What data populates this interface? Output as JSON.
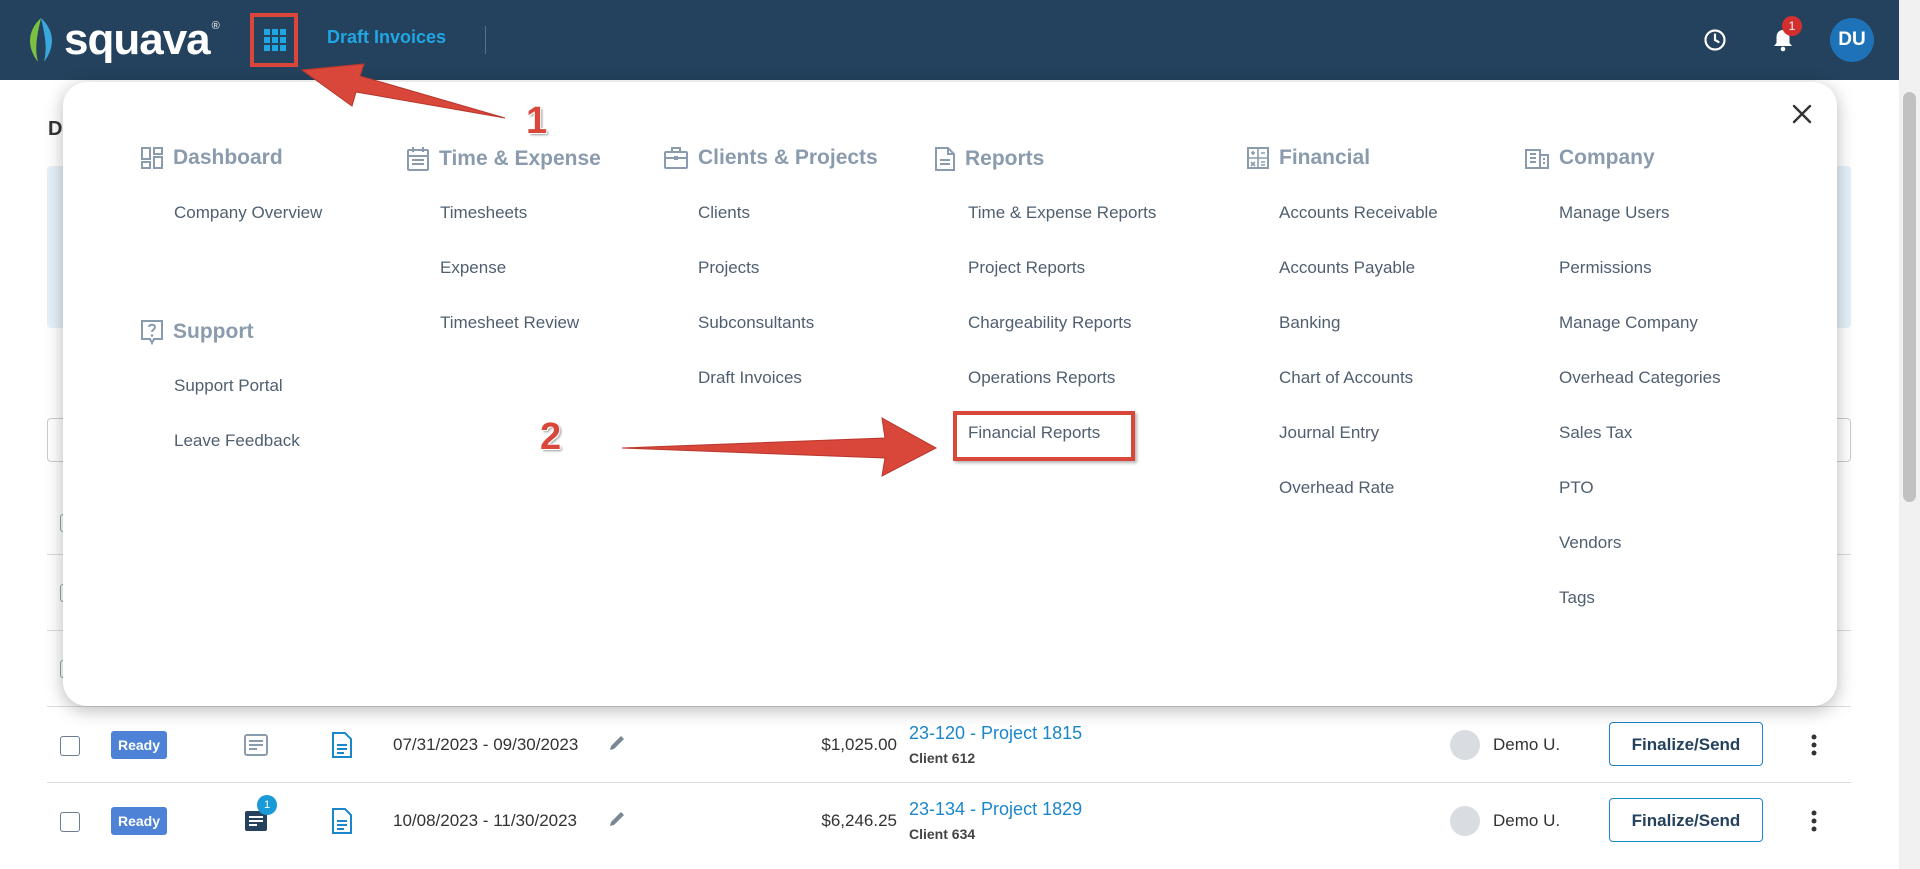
{
  "header": {
    "logo_text": "squava",
    "logo_mark": "®",
    "page_title": "Draft Invoices",
    "notification_count": "1",
    "user_initials": "DU"
  },
  "background": {
    "heading_fragment": "D"
  },
  "menu": {
    "columns": [
      {
        "heading": "Dashboard",
        "icon": "dashboard-icon",
        "items": [
          "Company Overview"
        ]
      },
      {
        "heading": "Time & Expense",
        "icon": "calendar-icon",
        "items": [
          "Timesheets",
          "Expense",
          "Timesheet Review"
        ]
      },
      {
        "heading": "Clients & Projects",
        "icon": "briefcase-icon",
        "items": [
          "Clients",
          "Projects",
          "Subconsultants",
          "Draft Invoices"
        ]
      },
      {
        "heading": "Reports",
        "icon": "report-icon",
        "items": [
          "Time & Expense Reports",
          "Project Reports",
          "Chargeability Reports",
          "Operations Reports",
          "Financial Reports"
        ]
      },
      {
        "heading": "Financial",
        "icon": "calculator-icon",
        "items": [
          "Accounts Receivable",
          "Accounts Payable",
          "Banking",
          "Chart of Accounts",
          "Journal Entry",
          "Overhead Rate"
        ]
      },
      {
        "heading": "Company",
        "icon": "building-icon",
        "items": [
          "Manage Users",
          "Permissions",
          "Manage Company",
          "Overhead Categories",
          "Sales Tax",
          "PTO",
          "Vendors",
          "Tags"
        ]
      }
    ],
    "support": {
      "heading": "Support",
      "icon": "help-icon",
      "items": [
        "Support Portal",
        "Leave Feedback"
      ]
    }
  },
  "annotations": {
    "step1": "1",
    "step2": "2"
  },
  "rows": [
    {
      "status": "Ready",
      "date_range": "07/31/2023 - 09/30/2023",
      "amount": "$1,025.00",
      "project": "23-120 - Project 1815",
      "client": "Client 612",
      "user": "Demo U.",
      "action": "Finalize/Send",
      "note_count": ""
    },
    {
      "status": "Ready",
      "date_range": "10/08/2023 - 11/30/2023",
      "amount": "$6,246.25",
      "project": "23-134 - Project 1829",
      "client": "Client 634",
      "user": "Demo U.",
      "action": "Finalize/Send",
      "note_count": "1"
    }
  ],
  "colors": {
    "header_bg": "#24425d",
    "accent": "#21a6e4",
    "annotation": "#d9463a",
    "status_ready": "#4d82d6"
  }
}
